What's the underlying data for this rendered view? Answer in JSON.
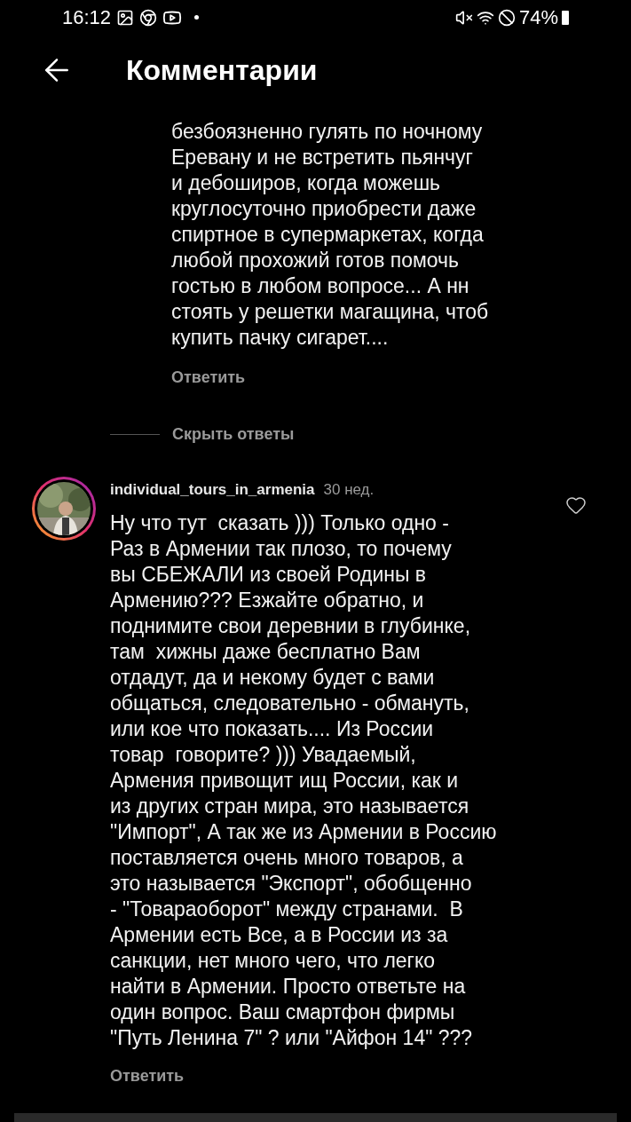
{
  "status_bar": {
    "time": "16:12",
    "battery": "74%"
  },
  "header": {
    "title": "Комментарии"
  },
  "reply": {
    "lines": [
      "безбоязненно гулять по ночному",
      "Еревану и не встретить пьянчуг",
      "и дебоширов, когда можешь",
      "круглосуточно приобрести даже",
      "спиртное в супермаркетах, когда",
      "любой прохожий готов помочь",
      "гостью в любом вопросе... А нн",
      "стоять у решетки магащина, чтоб",
      "купить пачку сигарет...."
    ],
    "reply_action": "Ответить"
  },
  "hide_replies": "Скрыть ответы",
  "comment": {
    "username": "individual_tours_in_armenia",
    "age": "30 нед.",
    "liked": false,
    "lines": [
      "Ну что тут  сказать ))) Только одно -",
      "Раз в Армении так плозо, то почему",
      "вы СБЕЖАЛИ из своей Родины в",
      "Армению??? Езжайте обратно, и",
      "поднимите свои деревнии в глубинке,",
      "там  хижны даже бесплатно Вам",
      "отдадут, да и некому будет с вами",
      "общаться, следовательно - обмануть,",
      "или кое что показать.... Из России",
      "товар  говорите? ))) Увадаемый,",
      "Армения привощит ищ России, как и",
      "из других стран мира, это называется",
      "\"Импорт\", А так же из Армении в Россию",
      "поставляется очень много товаров, а",
      "это называется \"Экспорт\", обобщенно",
      "- \"Товараоборот\" между странами.  В",
      "Армении есть Все, а в России из за",
      "санкции, нет много чего, что легко",
      "найти в Армении. Просто ответьте на",
      "один вопрос. Ваш смартфон фирмы",
      "\"Путь Ленина 7\" ? или \"Айфон 14\" ???"
    ],
    "reply_action": "Ответить"
  }
}
